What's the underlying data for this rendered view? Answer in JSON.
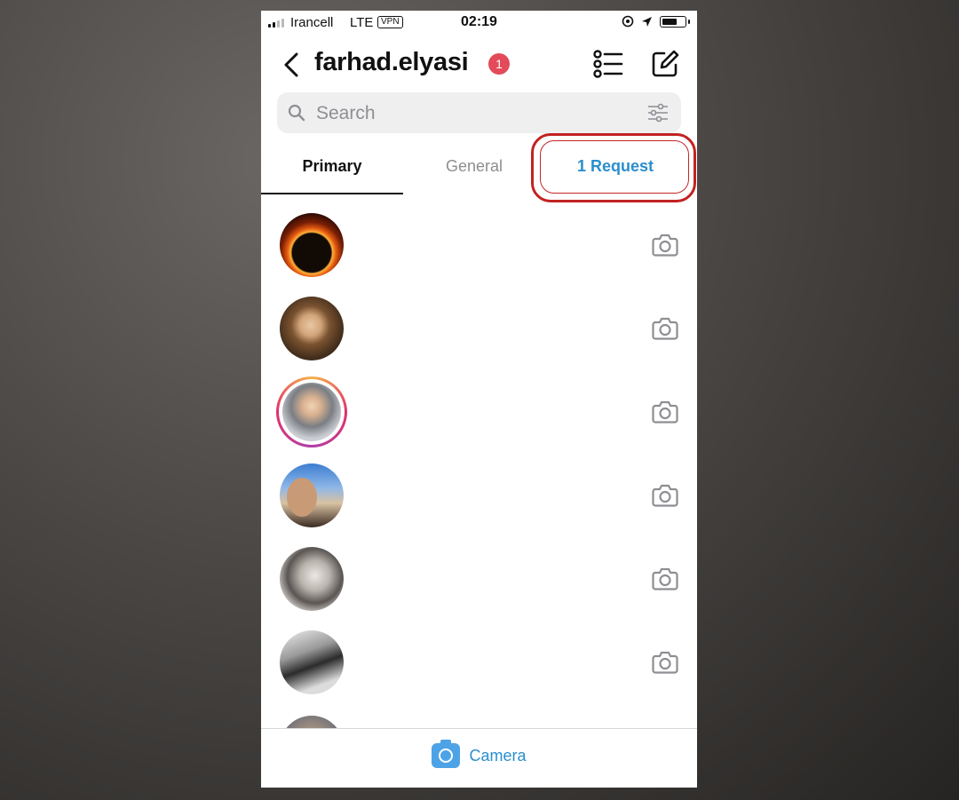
{
  "status_bar": {
    "carrier": "Irancell",
    "network": "LTE",
    "vpn": "VPN",
    "time": "02:19"
  },
  "header": {
    "username": "farhad.elyasi",
    "badge_count": "1"
  },
  "search": {
    "placeholder": "Search"
  },
  "tabs": {
    "primary": "Primary",
    "general": "General",
    "requests": "1 Request"
  },
  "threads": [
    {
      "avatar": "avatar-1",
      "has_story_ring": false
    },
    {
      "avatar": "avatar-2",
      "has_story_ring": false
    },
    {
      "avatar": "avatar-3",
      "has_story_ring": true
    },
    {
      "avatar": "avatar-4",
      "has_story_ring": false
    },
    {
      "avatar": "avatar-5",
      "has_story_ring": false
    },
    {
      "avatar": "avatar-6",
      "has_story_ring": false
    },
    {
      "avatar": "avatar-7",
      "has_story_ring": false
    }
  ],
  "bottom_bar": {
    "camera_label": "Camera"
  },
  "colors": {
    "accent_blue": "#2a8fce",
    "badge_red": "#e34a5a",
    "highlight_red": "#c22222"
  }
}
